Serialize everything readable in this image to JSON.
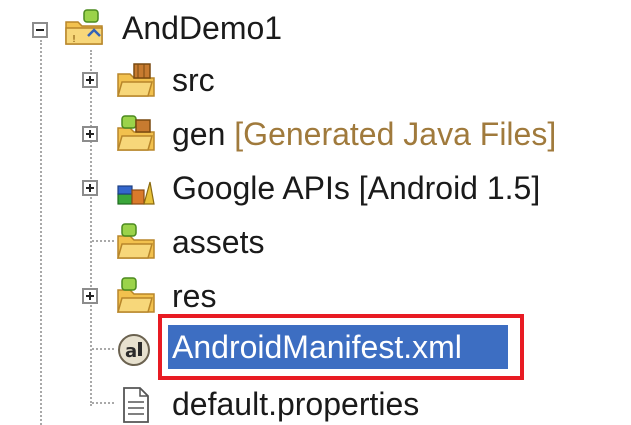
{
  "tree": {
    "root": {
      "label": "AndDemo1",
      "icon": "android-project-icon",
      "expanded": true
    },
    "children": [
      {
        "label": "src",
        "decoration": "",
        "icon": "source-package-folder-icon",
        "expander": "plus"
      },
      {
        "label": "gen",
        "decoration": "[Generated Java Files]",
        "icon": "generated-source-folder-icon",
        "expander": "plus"
      },
      {
        "label": "Google APIs [Android 1.5]",
        "decoration": "",
        "icon": "library-container-icon",
        "expander": "plus"
      },
      {
        "label": "assets",
        "decoration": "",
        "icon": "folder-icon",
        "expander": "none"
      },
      {
        "label": "res",
        "decoration": "",
        "icon": "folder-icon",
        "expander": "plus"
      },
      {
        "label": "AndroidManifest.xml",
        "decoration": "",
        "icon": "android-manifest-icon",
        "expander": "none",
        "selected": true
      },
      {
        "label": "default.properties",
        "decoration": "",
        "icon": "properties-file-icon",
        "expander": "none"
      }
    ]
  },
  "colors": {
    "selection": "#3d6ec2",
    "highlight_border": "#e81b23",
    "decoration_text": "#a07a3c"
  }
}
